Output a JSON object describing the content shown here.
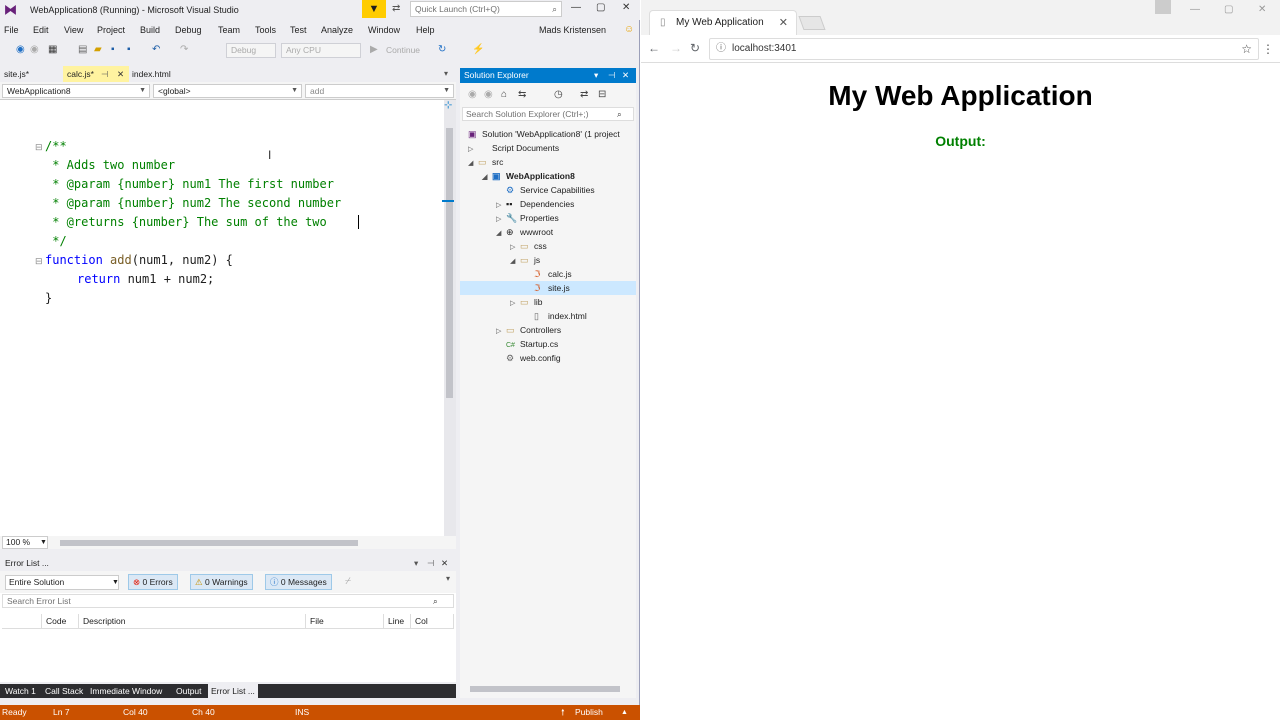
{
  "vs": {
    "window_title": "WebApplication8 (Running) - Microsoft Visual Studio",
    "quick_launch_placeholder": "Quick Launch (Ctrl+Q)",
    "user": "Mads Kristensen",
    "menu": [
      "File",
      "Edit",
      "View",
      "Project",
      "Build",
      "Debug",
      "Team",
      "Tools",
      "Test",
      "Analyze",
      "Window",
      "Help"
    ],
    "toolbar": {
      "config": "Debug",
      "platform": "Any CPU",
      "continue_label": "Continue"
    },
    "doc_tabs": [
      "site.js*",
      "calc.js*",
      "index.html"
    ],
    "nav": {
      "project": "WebApplication8",
      "scope": "<global>",
      "member": "add"
    },
    "code_lines": [
      "/**",
      " * Adds two number",
      " * @param {number} num1 The first number",
      " * @param {number} num2 The second number",
      " * @returns {number} The sum of the two",
      " */"
    ],
    "code": {
      "kw_function": "function",
      "fn_name": "add",
      "fn_params": "(num1, num2) {",
      "kw_return": "return",
      "return_expr": " num1 + num2;",
      "close_brace": "}"
    },
    "zoom": "100 %",
    "error_list": {
      "title": "Error List ...",
      "scope": "Entire Solution",
      "errors": "0 Errors",
      "warnings": "0 Warnings",
      "messages": "0 Messages",
      "search_placeholder": "Search Error List",
      "columns": [
        "Code",
        "Description",
        "File",
        "Line",
        "Col"
      ]
    },
    "bottom_tabs": [
      "Watch 1",
      "Call Stack",
      "Immediate Window",
      "Output",
      "Error List ..."
    ],
    "status": {
      "ready": "Ready",
      "ln": "Ln 7",
      "col": "Col 40",
      "ch": "Ch 40",
      "ins": "INS",
      "publish": "Publish"
    },
    "solution_explorer": {
      "title": "Solution Explorer",
      "search_placeholder": "Search Solution Explorer (Ctrl+;)",
      "items": [
        "Solution 'WebApplication8' (1 project",
        "Script Documents",
        "src",
        "WebApplication8",
        "Service Capabilities",
        "Dependencies",
        "Properties",
        "wwwroot",
        "css",
        "js",
        "calc.js",
        "site.js",
        "lib",
        "index.html",
        "Controllers",
        "Startup.cs",
        "web.config"
      ]
    }
  },
  "browser": {
    "tab_title": "My Web Application",
    "url": "localhost:3401",
    "page_heading": "My Web Application",
    "output_label": "Output:"
  },
  "colors": {
    "accent": "#007acc",
    "status_bar": "#ca5100",
    "comment": "#008000",
    "keyword": "#0000ff"
  }
}
